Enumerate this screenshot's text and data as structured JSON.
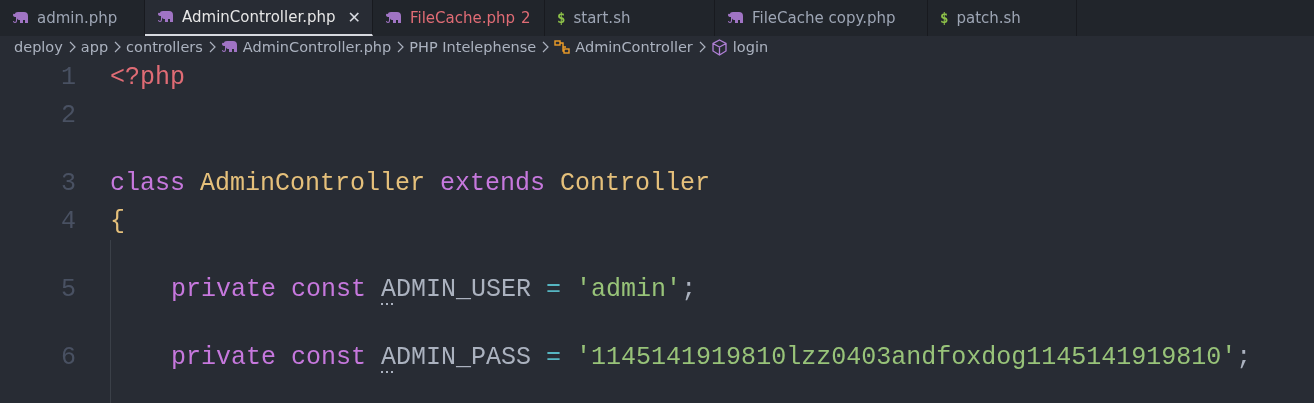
{
  "tabs": [
    {
      "label": "admin.php",
      "kind": "php",
      "selected": false,
      "error": false
    },
    {
      "label": "AdminController.php",
      "kind": "php",
      "selected": true,
      "error": false,
      "close": "✕"
    },
    {
      "label": "FileCache.php",
      "kind": "php",
      "selected": false,
      "error": true,
      "badge": "2"
    },
    {
      "label": "start.sh",
      "kind": "shell",
      "icon_text": "$",
      "selected": false,
      "error": false
    },
    {
      "label": "FileCache copy.php",
      "kind": "php",
      "selected": false,
      "error": false
    },
    {
      "label": "patch.sh",
      "kind": "shell",
      "icon_text": "$",
      "selected": false,
      "error": false
    }
  ],
  "breadcrumb": [
    {
      "label": "deploy",
      "kind": "folder"
    },
    {
      "label": "app",
      "kind": "folder"
    },
    {
      "label": "controllers",
      "kind": "folder"
    },
    {
      "label": "AdminController.php",
      "kind": "php"
    },
    {
      "label": "PHP Intelephense",
      "kind": "folder"
    },
    {
      "label": "AdminController",
      "kind": "class"
    },
    {
      "label": "login",
      "kind": "method"
    }
  ],
  "editor": {
    "lines": [
      {
        "kind": "code",
        "number": "1",
        "indent": false,
        "tokens": [
          {
            "text": "<?php",
            "kind": "tag"
          }
        ]
      },
      {
        "kind": "code",
        "number": "2",
        "indent": false
      },
      {
        "kind": "gap"
      },
      {
        "kind": "code",
        "number": "3",
        "indent": false,
        "tokens": [
          {
            "text": "class",
            "kind": "keyword"
          },
          {
            "text": " AdminController",
            "kind": "type"
          },
          {
            "text": " extends",
            "kind": "keyword"
          },
          {
            "text": " Controller",
            "kind": "type"
          }
        ]
      },
      {
        "kind": "code",
        "number": "4",
        "indent": false,
        "tokens": [
          {
            "text": "{",
            "kind": "brace"
          }
        ]
      },
      {
        "kind": "gap"
      },
      {
        "kind": "code",
        "number": "5",
        "indent": true,
        "tokens": [
          {
            "text": "private",
            "kind": "keyword"
          },
          {
            "text": " const",
            "kind": "keyword"
          },
          {
            "text": " ADMIN_USER",
            "kind": "constant",
            "hint": true
          },
          {
            "text": " =",
            "kind": "operator"
          },
          {
            "text": " 'admin'",
            "kind": "string"
          },
          {
            "text": ";",
            "kind": "plain"
          }
        ]
      },
      {
        "kind": "gap"
      },
      {
        "kind": "code",
        "number": "6",
        "indent": true,
        "tokens": [
          {
            "text": "private",
            "kind": "keyword"
          },
          {
            "text": " const",
            "kind": "keyword"
          },
          {
            "text": " ADMIN_PASS",
            "kind": "constant",
            "hint": true
          },
          {
            "text": " =",
            "kind": "operator"
          },
          {
            "text": " '1145141919810lzz0403andfoxdog1145141919810'",
            "kind": "string"
          },
          {
            "text": ";",
            "kind": "plain"
          }
        ]
      },
      {
        "kind": "gap"
      }
    ]
  }
}
